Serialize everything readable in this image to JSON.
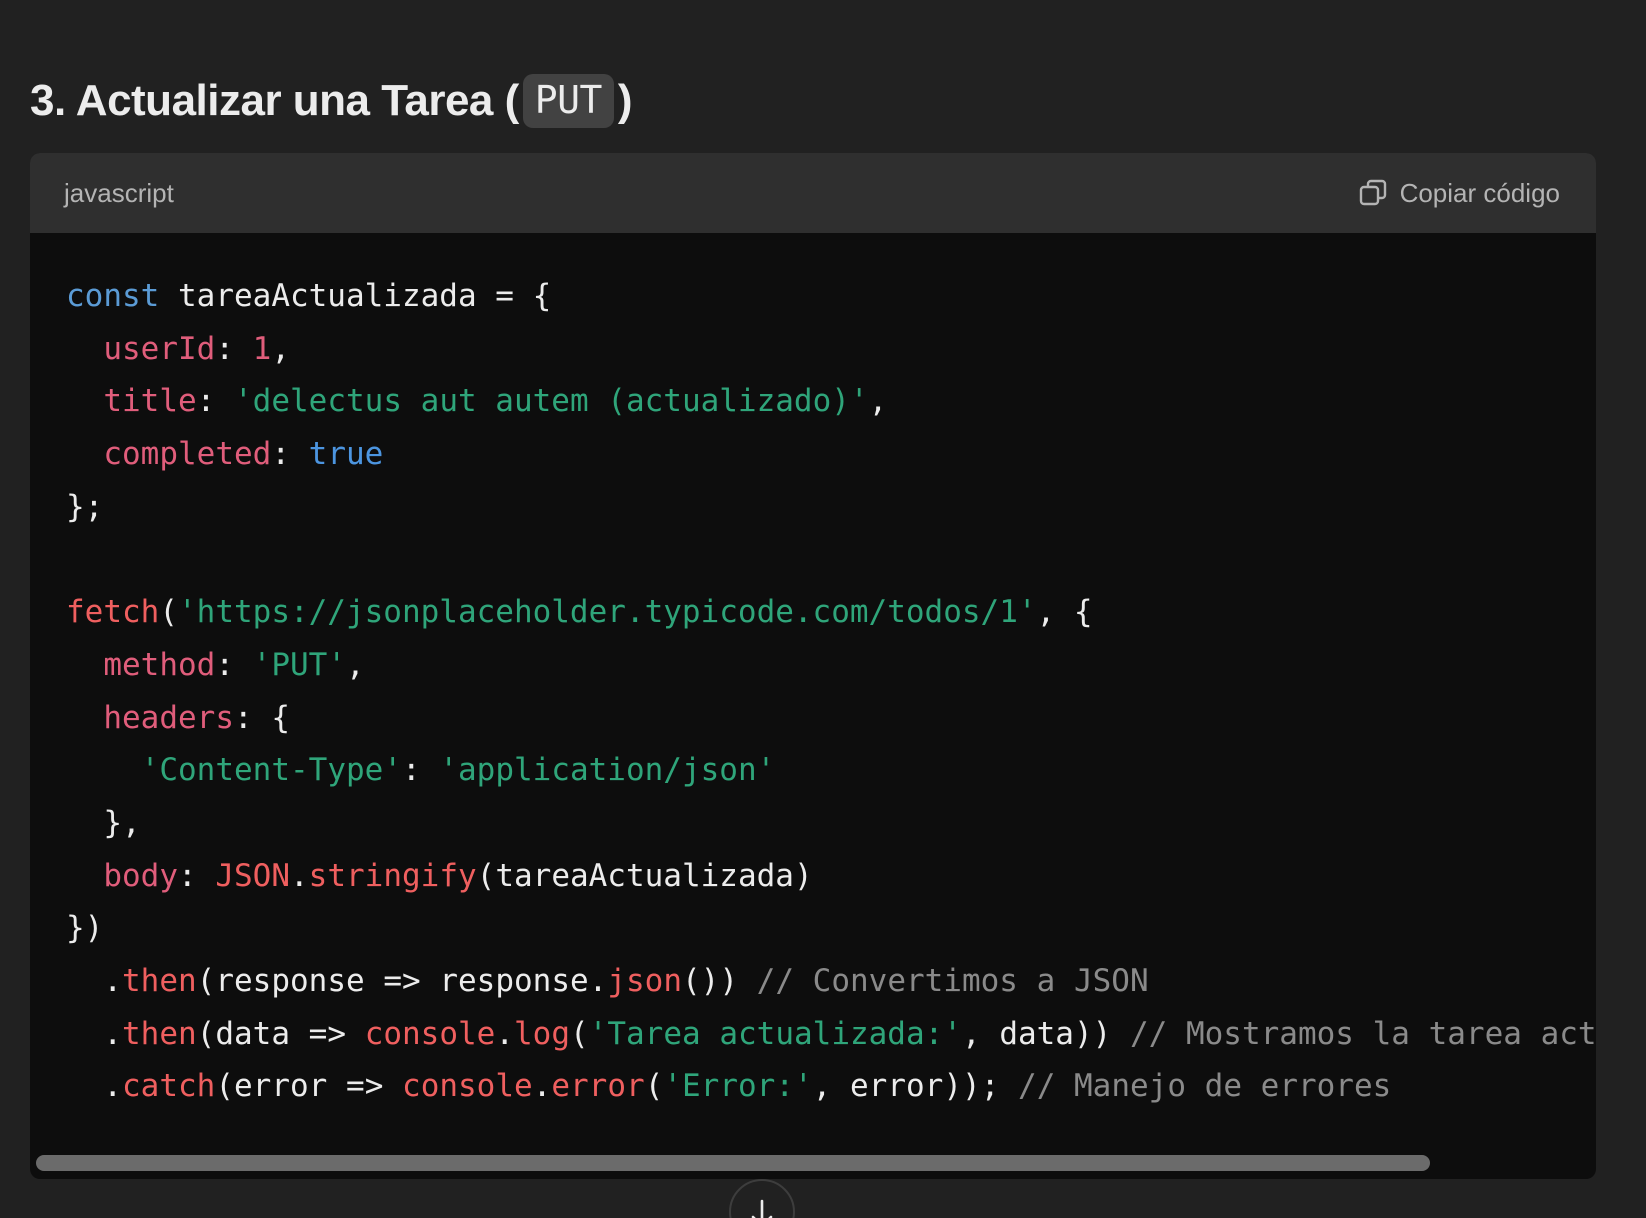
{
  "heading": {
    "prefix": "3. Actualizar una Tarea (",
    "code": "PUT",
    "suffix": ")"
  },
  "code_block": {
    "language": "javascript",
    "copy_label": "Copiar código",
    "copy_icon": "copy-icon",
    "scroll_icon": "arrow-down-icon",
    "lines": [
      "const tareaActualizada = {",
      "  userId: 1,",
      "  title: 'delectus aut autem (actualizado)',",
      "  completed: true",
      "};",
      "",
      "fetch('https://jsonplaceholder.typicode.com/todos/1', {",
      "  method: 'PUT',",
      "  headers: {",
      "    'Content-Type': 'application/json'",
      "  },",
      "  body: JSON.stringify(tareaActualizada)",
      "})",
      "  .then(response => response.json()) // Convertimos a JSON",
      "  .then(data => console.log('Tarea actualizada:', data)) // Mostramos la tarea actu",
      "  .catch(error => console.error('Error:', error)); // Manejo de errores"
    ]
  },
  "colors": {
    "background": "#212121",
    "code_background": "#0d0d0d",
    "header_background": "#2f2f2f",
    "keyword": "#5b9bd5",
    "property": "#e05d7b",
    "string": "#2fa57a",
    "function": "#ef5f5f",
    "comment": "#8a8a8a"
  }
}
